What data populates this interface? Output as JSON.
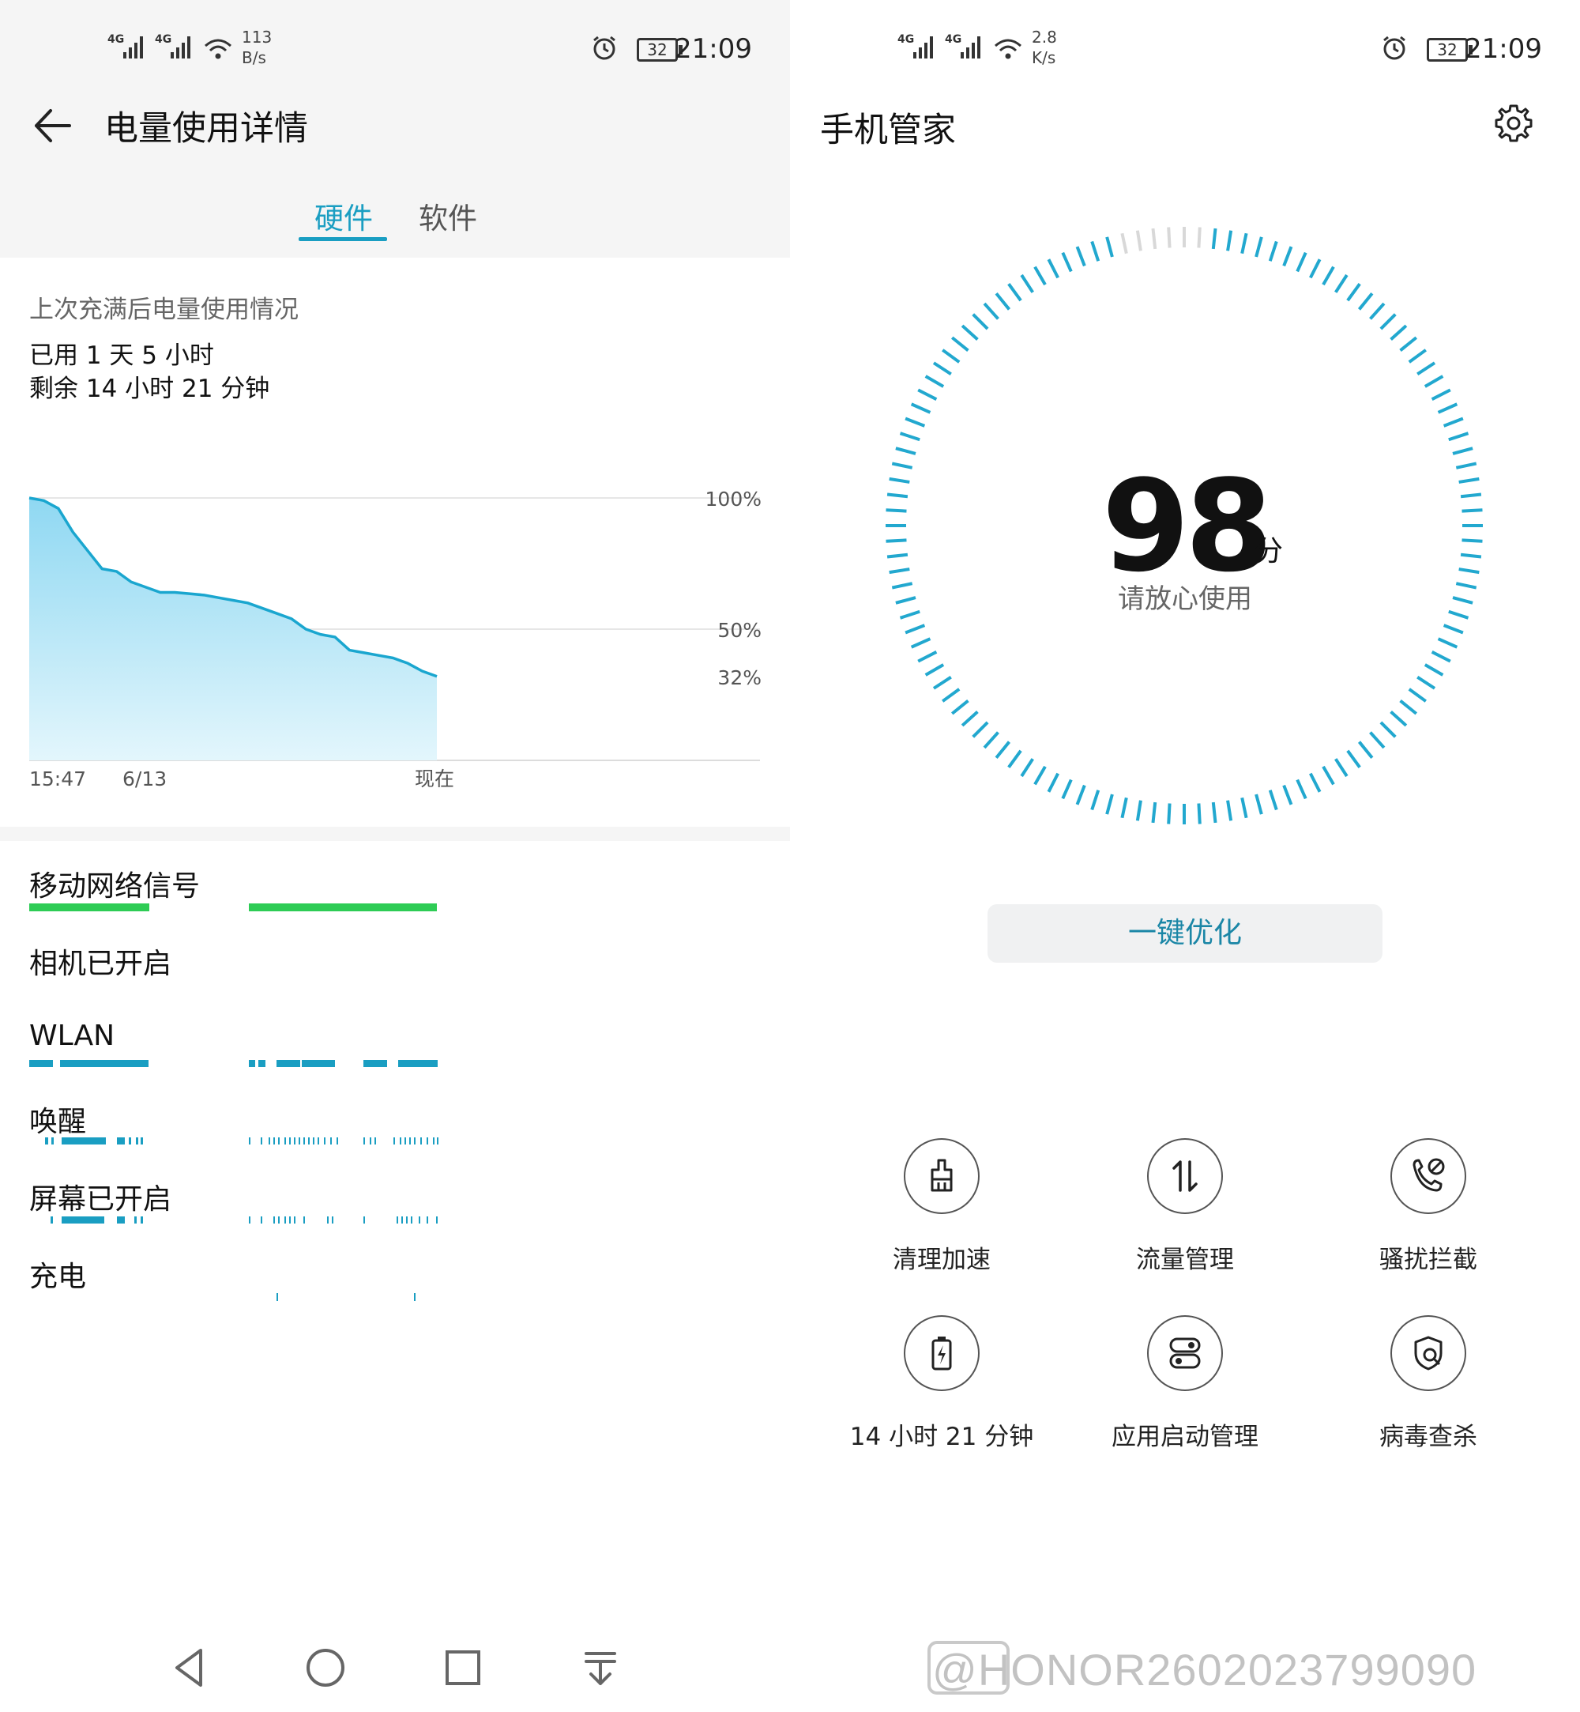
{
  "colors": {
    "accent": "#1a9ec2",
    "signal_green": "#2ecc55",
    "track_teal": "#1a9ec2",
    "chart_fill": "#a9e2f4"
  },
  "left": {
    "status": {
      "network1": "4G",
      "network2": "4G",
      "speed_value": "113",
      "speed_unit": "B/s",
      "battery": "32",
      "time": "21:09"
    },
    "title": "电量使用详情",
    "tabs": [
      "硬件",
      "软件"
    ],
    "summary": {
      "heading": "上次充满后电量使用情况",
      "used": "已用 1 天 5 小时",
      "remaining": "剩余 14 小时 21 分钟"
    },
    "hardware": [
      "移动网络信号",
      "相机已开启",
      "WLAN",
      "唤醒",
      "屏幕已开启",
      "充电"
    ]
  },
  "chart_data": {
    "type": "area",
    "title": "",
    "x_tick_labels": [
      "15:47",
      "6/13",
      "现在"
    ],
    "y_tick_labels": [
      "100%",
      "50%",
      "32%"
    ],
    "ylim": [
      0,
      100
    ],
    "series": [
      {
        "values": [
          100,
          99,
          96,
          87,
          80,
          73,
          72,
          68,
          66,
          64,
          64,
          63.5,
          63,
          62,
          61,
          60,
          58,
          56,
          54,
          50,
          48,
          47,
          42,
          41,
          40,
          39,
          37,
          34,
          32
        ]
      }
    ],
    "grid": true
  },
  "right": {
    "status": {
      "network1": "4G",
      "network2": "4G",
      "speed_value": "2.8",
      "speed_unit": "K/s",
      "battery": "32",
      "time": "21:09"
    },
    "title": "手机管家",
    "score": "98",
    "score_unit": "分",
    "score_message": "请放心使用",
    "optimize_button": "一键优化",
    "tools": [
      {
        "icon": "broom-icon",
        "label": "清理加速"
      },
      {
        "icon": "data-transfer-icon",
        "label": "流量管理"
      },
      {
        "icon": "phone-block-icon",
        "label": "骚扰拦截"
      },
      {
        "icon": "battery-icon",
        "label": "14 小时 21 分钟"
      },
      {
        "icon": "app-launch-icon",
        "label": "应用启动管理"
      },
      {
        "icon": "shield-search-icon",
        "label": "病毒查杀"
      }
    ]
  },
  "watermark": "@HONOR2602023799090"
}
